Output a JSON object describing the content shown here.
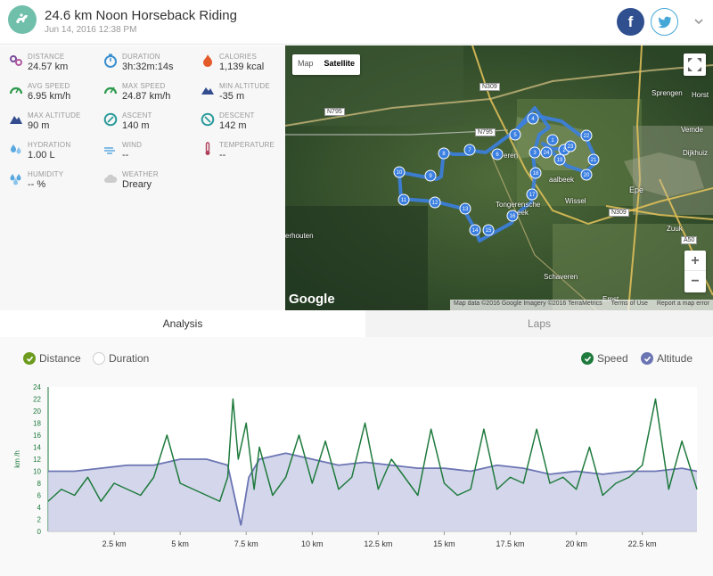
{
  "header": {
    "title": "24.6 km Noon Horseback Riding",
    "subtitle": "Jun 14, 2016 12:38 PM",
    "facebook_label": "f"
  },
  "stats": [
    {
      "id": "distance",
      "label": "Distance",
      "value": "24.57 km",
      "icon": "route-icon",
      "color": "#7a4a9a"
    },
    {
      "id": "duration",
      "label": "Duration",
      "value": "3h:32m:14s",
      "icon": "stopwatch-icon",
      "color": "#3a8fd0"
    },
    {
      "id": "calories",
      "label": "Calories",
      "value": "1,139 kcal",
      "icon": "flame-icon",
      "color": "#e45a2b"
    },
    {
      "id": "avg_speed",
      "label": "Avg Speed",
      "value": "6.95 km/h",
      "icon": "speedometer-icon",
      "color": "#2e9a4d"
    },
    {
      "id": "max_speed",
      "label": "Max Speed",
      "value": "24.87 km/h",
      "icon": "speedometer-icon",
      "color": "#2e9a4d"
    },
    {
      "id": "min_altitude",
      "label": "Min Altitude",
      "value": "-35 m",
      "icon": "mountain-icon",
      "color": "#334d8f"
    },
    {
      "id": "max_altitude",
      "label": "Max Altitude",
      "value": "90 m",
      "icon": "mountain-icon",
      "color": "#334d8f"
    },
    {
      "id": "ascent",
      "label": "Ascent",
      "value": "140 m",
      "icon": "ascent-icon",
      "color": "#2a9a9a"
    },
    {
      "id": "descent",
      "label": "Descent",
      "value": "142 m",
      "icon": "descent-icon",
      "color": "#2a9a9a"
    },
    {
      "id": "hydration",
      "label": "Hydration",
      "value": "1.00 L",
      "icon": "water-drops-icon",
      "color": "#5aa8e0"
    },
    {
      "id": "wind",
      "label": "Wind",
      "value": "--",
      "icon": "wind-icon",
      "color": "#5aa8e0"
    },
    {
      "id": "temperature",
      "label": "Temperature",
      "value": "--",
      "icon": "thermometer-icon",
      "color": "#b0405a"
    },
    {
      "id": "humidity",
      "label": "Humidity",
      "value": "-- %",
      "icon": "humidity-icon",
      "color": "#5aa8e0"
    },
    {
      "id": "weather",
      "label": "Weather",
      "value": "Dreary",
      "icon": "cloud-icon",
      "color": "#bbbbbb"
    }
  ],
  "map": {
    "type_map": "Map",
    "type_satellite": "Satellite",
    "logo": "Google",
    "attribution": [
      "Map data ©2016 Google Imagery ©2016 TerraMetrics",
      "Terms of Use",
      "Report a map error"
    ],
    "places": [
      "Sprengen",
      "Horst",
      "Vemde",
      "Dijkhuiz",
      "Epe",
      "Zuuk",
      "Wissel",
      "aalbeek",
      "Tongerensche",
      "eek",
      "erhouten",
      "Schaveren",
      "Emst",
      "eren"
    ],
    "roads": [
      "N309",
      "N795",
      "N795",
      "N309",
      "A50"
    ],
    "zoom_in": "+",
    "zoom_out": "−",
    "waypoints": [
      "1",
      "2",
      "3",
      "4",
      "5",
      "6",
      "7",
      "8",
      "9",
      "10",
      "11",
      "12",
      "13",
      "14",
      "15",
      "16",
      "17",
      "18",
      "19",
      "20",
      "21",
      "22",
      "23",
      "24"
    ]
  },
  "tabs": {
    "analysis": "Analysis",
    "laps": "Laps"
  },
  "analysis": {
    "x_mode_distance": "Distance",
    "x_mode_duration": "Duration",
    "speed_label": "Speed",
    "altitude_label": "Altitude"
  },
  "chart_data": {
    "type": "line",
    "ylabel": "km /h",
    "ylim": [
      0,
      24
    ],
    "yticks": [
      0,
      2,
      4,
      6,
      8,
      10,
      12,
      14,
      16,
      18,
      20,
      22,
      24
    ],
    "xlim": [
      0,
      24.57
    ],
    "xticks": [
      2.5,
      5,
      7.5,
      10,
      12.5,
      15,
      17.5,
      20,
      22.5
    ],
    "xtick_labels": [
      "2.5 km",
      "5 km",
      "7.5 km",
      "10 km",
      "12.5 km",
      "15 km",
      "17.5 km",
      "20 km",
      "22.5 km"
    ],
    "series": [
      {
        "name": "Speed",
        "color": "#1f7a3d",
        "x": [
          0,
          0.5,
          1,
          1.5,
          2,
          2.5,
          3,
          3.5,
          4,
          4.5,
          5,
          5.5,
          6,
          6.5,
          6.8,
          7,
          7.2,
          7.5,
          7.8,
          8,
          8.5,
          9,
          9.5,
          10,
          10.5,
          11,
          11.5,
          12,
          12.5,
          13,
          13.5,
          14,
          14.5,
          15,
          15.5,
          16,
          16.5,
          17,
          17.5,
          18,
          18.5,
          19,
          19.5,
          20,
          20.5,
          21,
          21.5,
          22,
          22.5,
          23,
          23.5,
          24,
          24.57
        ],
        "y": [
          5,
          7,
          6,
          9,
          5,
          8,
          7,
          6,
          9,
          16,
          8,
          7,
          6,
          5,
          9,
          22,
          12,
          18,
          7,
          14,
          6,
          9,
          16,
          8,
          15,
          7,
          9,
          18,
          7,
          12,
          9,
          6,
          17,
          8,
          6,
          7,
          17,
          7,
          9,
          8,
          17,
          8,
          9,
          7,
          14,
          6,
          8,
          9,
          11,
          22,
          7,
          15,
          7
        ]
      },
      {
        "name": "Altitude",
        "color": "#6b75b3",
        "x": [
          0,
          1,
          2,
          3,
          4,
          5,
          6,
          6.8,
          7,
          7.3,
          7.6,
          8,
          9,
          10,
          11,
          12,
          13,
          14,
          15,
          16,
          17,
          18,
          19,
          20,
          21,
          22,
          23,
          24,
          24.57
        ],
        "y": [
          10,
          10,
          10.5,
          11,
          11,
          12,
          12,
          11,
          7,
          1,
          9,
          12,
          13,
          12,
          11,
          11.5,
          11,
          10.5,
          10.5,
          10,
          11,
          10.5,
          9.5,
          10,
          9.5,
          10,
          10,
          10.5,
          10
        ]
      }
    ]
  }
}
